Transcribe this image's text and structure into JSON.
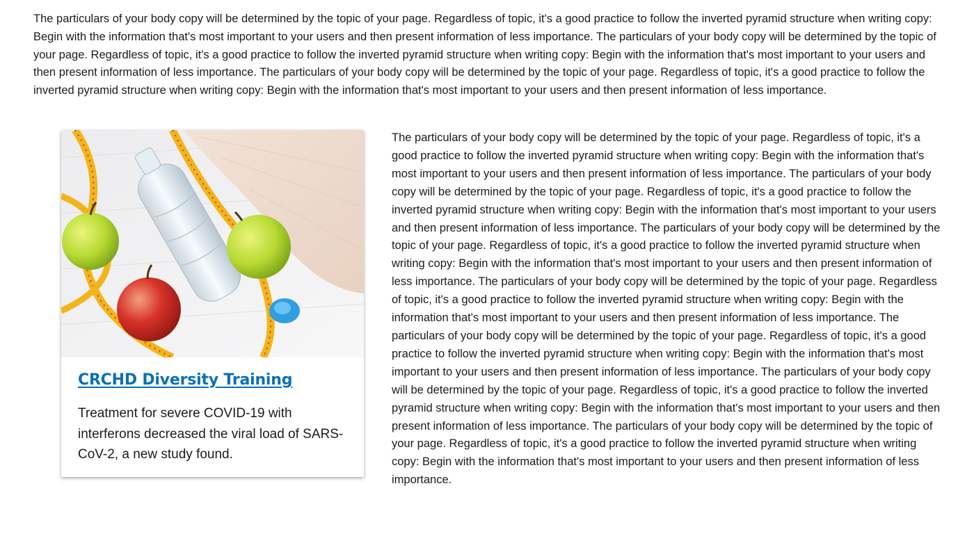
{
  "intro": {
    "text": "The particulars of your body copy will be determined by the topic of your page. Regardless of topic, it's a good practice to follow the inverted pyramid structure when writing copy: Begin with the information that's most important to your users and then present information of less importance. The particulars of your body copy will be determined by the topic of your page. Regardless of topic, it's a good practice to follow the inverted pyramid structure when writing copy: Begin with the information that's most important to your users and then present information of less importance. The particulars of your body copy will be determined by the topic of your page. Regardless of topic, it's a good practice to follow the inverted pyramid structure when writing copy: Begin with the information that's most important to your users and then present information of less importance."
  },
  "card": {
    "image_icon": "fitness-photo-apples-water-bottle-measuring-tape-towel",
    "title": "CRCHD Diversity Training",
    "description": "Treatment for severe COVID-19 with interferons decreased the viral load of SARS-CoV-2, a new study found.",
    "title_color": "#0a70b5"
  },
  "body": {
    "text": "The particulars of your body copy will be determined by the topic of your page. Regardless of topic, it's a good practice to follow the inverted pyramid structure when writing copy: Begin with the information that's most important to your users and then present information of less importance. The particulars of your body copy will be determined by the topic of your page. Regardless of topic, it's a good practice to follow the inverted pyramid structure when writing copy: Begin with the information that's most important to your users and then present information of less importance. The particulars of your body copy will be determined by the topic of your page. Regardless of topic, it's a good practice to follow the inverted pyramid structure when writing copy: Begin with the information that's most important to your users and then present information of less importance. The particulars of your body copy will be determined by the topic of your page. Regardless of topic, it's a good practice to follow the inverted pyramid structure when writing copy: Begin with the information that's most important to your users and then present information of less importance. The particulars of your body copy will be determined by the topic of your page. Regardless of topic, it's a good practice to follow the inverted pyramid structure when writing copy: Begin with the information that's most important to your users and then present information of less importance. The particulars of your body copy will be determined by the topic of your page. Regardless of topic, it's a good practice to follow the inverted pyramid structure when writing copy: Begin with the information that's most important to your users and then present information of less importance. The particulars of your body copy will be determined by the topic of your page. Regardless of topic, it's a good practice to follow the inverted pyramid structure when writing copy: Begin with the information that's most important to your users and then present information of less importance."
  }
}
